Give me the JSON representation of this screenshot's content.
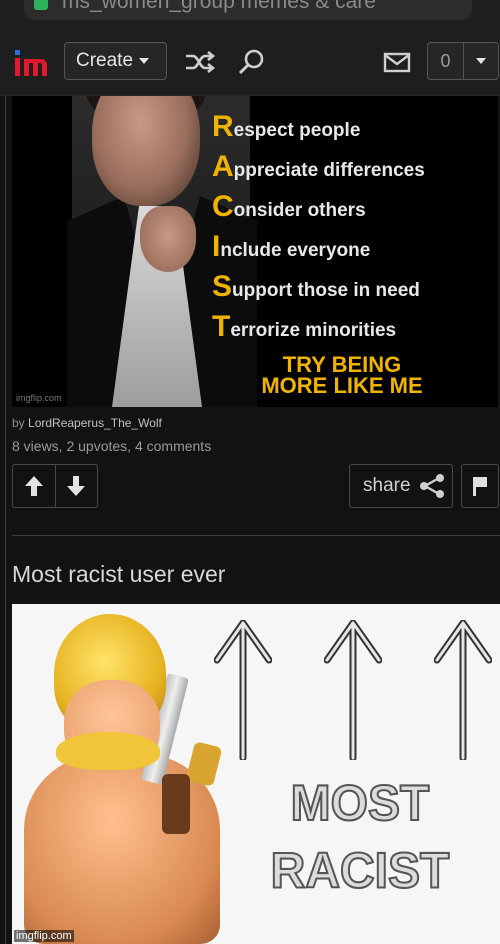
{
  "browser": {
    "url": "ms_women_group memes & care"
  },
  "nav": {
    "logo_text": "im",
    "create_label": "Create",
    "notification_count": "0",
    "icons": [
      "shuffle-icon",
      "search-icon",
      "mail-icon"
    ]
  },
  "post1": {
    "acrostic": [
      {
        "letter": "R",
        "rest": "espect people"
      },
      {
        "letter": "A",
        "rest": "ppreciate differences"
      },
      {
        "letter": "C",
        "rest": "onsider others"
      },
      {
        "letter": "I",
        "rest": "nclude everyone"
      },
      {
        "letter": "S",
        "rest": "upport those in need"
      },
      {
        "letter": "T",
        "rest": "errorize minorities"
      }
    ],
    "tagline_line1": "TRY BEING",
    "tagline_line2": "MORE LIKE ME",
    "watermark": "imgflip.com",
    "by_prefix": "by ",
    "author": "LordReaperus_The_Wolf",
    "stats": "8 views, 2 upvotes, 4 comments",
    "share_label": "share"
  },
  "post2": {
    "title": "Most racist user ever",
    "meme_line1": "MOST",
    "meme_line2": "RACIST",
    "watermark": "imgflip.com"
  },
  "colors": {
    "background": "#121212",
    "accent_yellow": "#f0b400",
    "logo_red": "#e2182c",
    "logo_blue": "#2a6fe0"
  }
}
